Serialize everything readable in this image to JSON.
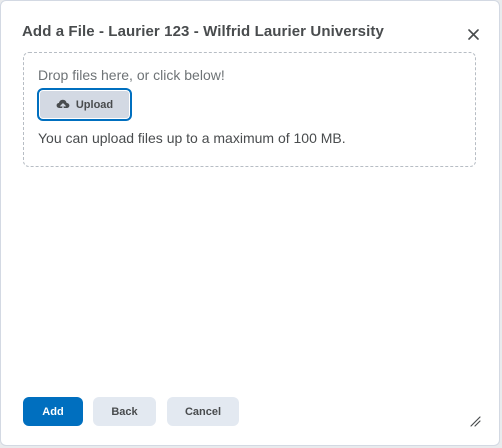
{
  "dialog": {
    "title": "Add a File - Laurier 123 - Wilfrid Laurier University",
    "close_icon": "close-icon"
  },
  "dropzone": {
    "prompt": "Drop files here, or click below!",
    "upload_label": "Upload",
    "upload_icon": "cloud-upload-icon",
    "limit_text": "You can upload files up to a maximum of 100 MB."
  },
  "footer": {
    "add_label": "Add",
    "back_label": "Back",
    "cancel_label": "Cancel"
  },
  "colors": {
    "primary": "#006fbf",
    "secondary_bg": "#e3e9f1",
    "text": "#494c4e"
  }
}
